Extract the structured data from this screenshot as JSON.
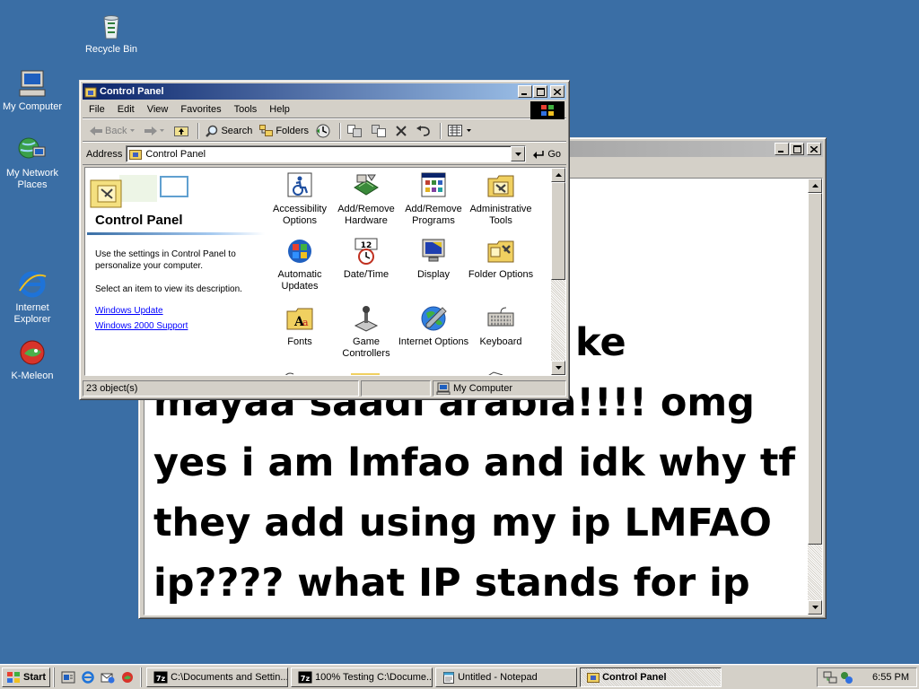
{
  "desktop": {
    "icons": [
      {
        "label": "Recycle Bin"
      },
      {
        "label": "My Computer"
      },
      {
        "label": "My Network Places"
      },
      {
        "label": "Internet Explorer"
      },
      {
        "label": "K-Meleon"
      }
    ]
  },
  "notepad": {
    "text_lines": [
      "ke",
      "mayaa saadi arabia!!!! omg",
      "yes i am lmfao and idk why tf",
      "they add using my ip LMFAO",
      "ip???? what IP stands for ip"
    ]
  },
  "control_panel": {
    "title": "Control Panel",
    "menu": [
      "File",
      "Edit",
      "View",
      "Favorites",
      "Tools",
      "Help"
    ],
    "toolbar": {
      "back": "Back",
      "search": "Search",
      "folders": "Folders"
    },
    "address": {
      "label": "Address",
      "value": "Control Panel",
      "go": "Go"
    },
    "left_pane": {
      "heading": "Control Panel",
      "description": "Use the settings in Control Panel to personalize your computer.",
      "hint": "Select an item to view its description.",
      "links": [
        "Windows Update",
        "Windows 2000 Support"
      ]
    },
    "items": [
      {
        "label": "Accessibility Options",
        "icon": "accessibility-icon"
      },
      {
        "label": "Add/Remove Hardware",
        "icon": "hardware-icon"
      },
      {
        "label": "Add/Remove Programs",
        "icon": "programs-icon"
      },
      {
        "label": "Administrative Tools",
        "icon": "admin-tools-icon"
      },
      {
        "label": "Automatic Updates",
        "icon": "windows-update-icon"
      },
      {
        "label": "Date/Time",
        "icon": "clock-icon"
      },
      {
        "label": "Display",
        "icon": "display-icon"
      },
      {
        "label": "Folder Options",
        "icon": "folder-options-icon"
      },
      {
        "label": "Fonts",
        "icon": "fonts-icon"
      },
      {
        "label": "Game Controllers",
        "icon": "joystick-icon"
      },
      {
        "label": "Internet Options",
        "icon": "globe-icon"
      },
      {
        "label": "Keyboard",
        "icon": "keyboard-icon"
      }
    ],
    "status": {
      "count": "23 object(s)",
      "zone": "My Computer"
    }
  },
  "taskbar": {
    "start": "Start",
    "tasks": [
      {
        "label": "C:\\Documents and Settin...",
        "active": false
      },
      {
        "label": "100% Testing C:\\Docume...",
        "active": false
      },
      {
        "label": "Untitled - Notepad",
        "active": false
      },
      {
        "label": "Control Panel",
        "active": true
      }
    ],
    "clock": "6:55 PM"
  },
  "colors": {
    "desktop": "#3a6ea5",
    "title_active": "#0a246a",
    "title_inactive": "#808080",
    "link": "#0000ff"
  }
}
